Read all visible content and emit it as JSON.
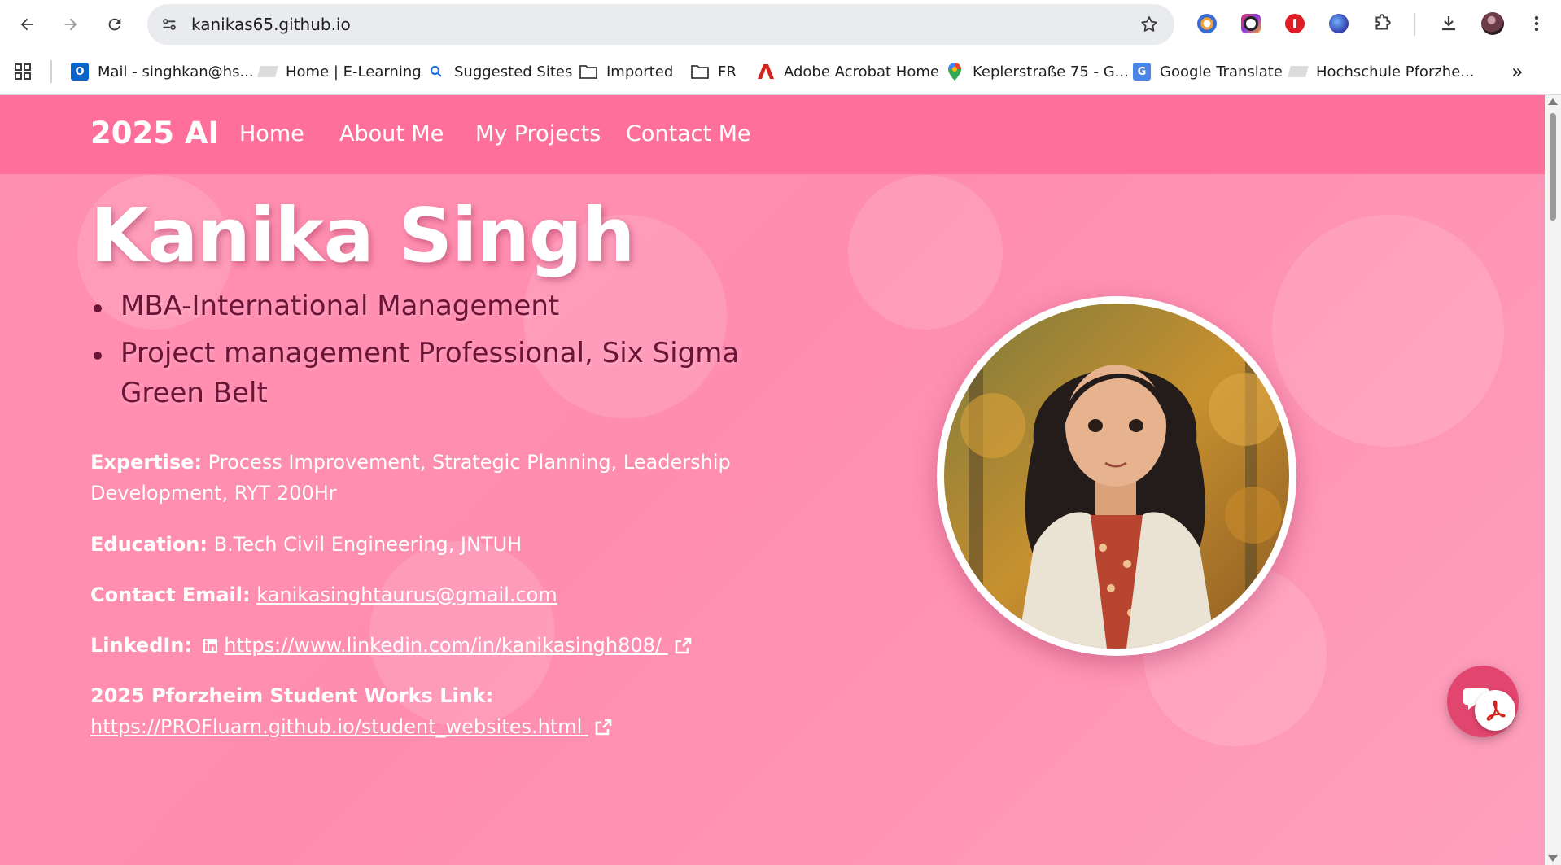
{
  "browser": {
    "url": "kanikas65.github.io",
    "bookmarks": [
      {
        "label": "Mail - singhkan@hs...",
        "icon": "outlook-icon"
      },
      {
        "label": "Home | E-Learning",
        "icon": "page-icon"
      },
      {
        "label": "Suggested Sites",
        "icon": "search-icon"
      },
      {
        "label": "Imported",
        "icon": "folder-icon"
      },
      {
        "label": "FR",
        "icon": "folder-icon"
      },
      {
        "label": "Adobe Acrobat Home",
        "icon": "acrobat-icon"
      },
      {
        "label": "Keplerstraße 75 - G...",
        "icon": "map-pin-icon"
      },
      {
        "label": "Google Translate",
        "icon": "translate-icon"
      },
      {
        "label": "Hochschule Pforzhe...",
        "icon": "page-icon"
      }
    ],
    "more_bookmarks": "»"
  },
  "site": {
    "brand": "2025 AI",
    "nav": [
      "Home",
      "About Me",
      "My Projects",
      "Contact Me"
    ]
  },
  "hero": {
    "name": "Kanika Singh",
    "highlights": [
      "MBA-International Management",
      "Project management Professional, Six Sigma Green Belt"
    ],
    "expertise_label": "Expertise:",
    "expertise_value": "Process Improvement, Strategic Planning, Leadership Development, RYT 200Hr",
    "education_label": "Education:",
    "education_value": "B.Tech Civil Engineering, JNTUH",
    "email_label": "Contact Email:",
    "email_value": "kanikasinghtaurus@gmail.com",
    "linkedin_label": "LinkedIn:",
    "linkedin_value": " https://www.linkedin.com/in/kanikasingh808/ ",
    "works_label": "2025 Pforzheim Student Works Link:",
    "works_value": "https://PROFluarn.github.io/student_websites.html "
  },
  "colors": {
    "nav_bar": "#ff6f9c",
    "page_background": "#ff8fb0",
    "bullet_text": "#6a1538",
    "chat_button": "#e2456d"
  }
}
